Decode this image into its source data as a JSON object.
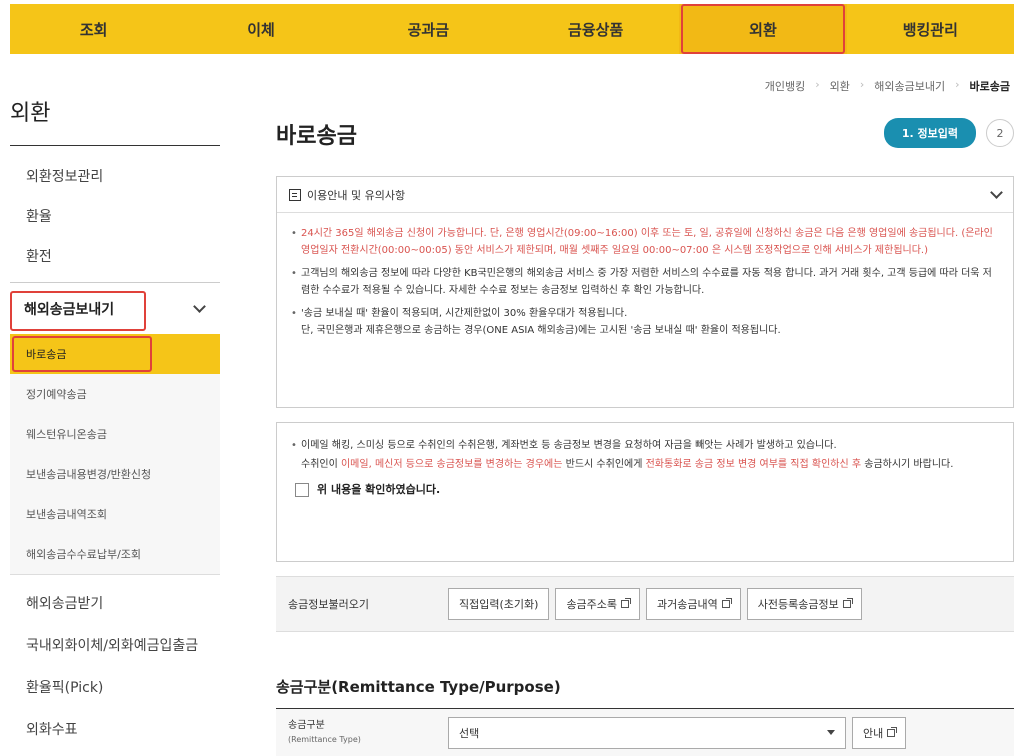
{
  "topnav": {
    "items": [
      "조회",
      "이체",
      "공과금",
      "금융상품",
      "외환",
      "뱅킹관리"
    ],
    "active_index": 4
  },
  "breadcrumb": [
    "개인뱅킹",
    "외환",
    "해외송금보내기",
    "바로송금"
  ],
  "sidebar": {
    "title": "외환",
    "items": [
      "외환정보관리",
      "환율",
      "환전"
    ],
    "group_label": "해외송금보내기",
    "sub_items": [
      "바로송금",
      "정기예약송금",
      "웨스턴유니온송금",
      "보낸송금내용변경/반환신청",
      "보낸송금내역조회",
      "해외송금수수료납부/조회"
    ],
    "after_items": [
      "해외송금받기",
      "국내외화이체/외화예금입출금",
      "환율픽(Pick)",
      "외화수표"
    ]
  },
  "main": {
    "title": "바로송금",
    "step_active": "1. 정보입력",
    "step_next": "2"
  },
  "notice": {
    "title": "이용안내 및 유의사항",
    "p1": "24시간 365일 해외송금 신청이 가능합니다. 단, 은행 영업시간(09:00~16:00) 이후 또는 토, 일, 공휴일에 신청하신 송금은 다음 은행 영업일에 송금됩니다. (은라인 영업일자 전환시간(00:00~00:05) 동안 서비스가 제한되며, 매월 셋째주 일요일 00:00~07:00 은 시스템 조정작업으로 인해 서비스가 제한됩니다.)",
    "p2": "고객님의 해외송금 정보에 따라 다양한 KB국민은행의 해외송금 서비스 중 가장 저렴한 서비스의 수수료를 자동 적용 합니다. 과거 거래 횟수, 고객 등급에 따라 더욱 저렴한 수수료가 적용될 수 있습니다. 자세한 수수료 정보는 송금정보 입력하신 후 확인 가능합니다.",
    "p3a": "'송금 보내실 때' 환율이 적용되며, 시간제한없이 30% 환율우대가 적용됩니다.",
    "p3b": "단, 국민은행과 제휴은행으로 송금하는 경우(ONE ASIA 해외송금)에는 고시된 '송금 보내실 때' 환율이 적용됩니다."
  },
  "warning": {
    "p1": "이메일 해킹, 스미싱 등으로 수취인의 수취은행, 계좌번호 등 송금정보 변경을 요청하여 자금을 빼앗는 사례가 발생하고 있습니다.",
    "p2_a": "수취인이 ",
    "p2_b": "이메일, 메신저 등으로 송금정보를 변경하는 경우에는",
    "p2_c": " 반드시 수취인에게 ",
    "p2_d": "전화통화로 송금 정보 변경 여부를 직접 확인하신 후",
    "p2_e": " 송금하시기 바랍니다.",
    "checkbox_label": "위 내용을 확인하였습니다."
  },
  "load": {
    "label": "송금정보불러오기",
    "buttons": [
      "직접입력(초기화)",
      "송금주소록",
      "과거송금내역",
      "사전등록송금정보"
    ]
  },
  "remit_type": {
    "section_title": "송금구분(Remittance Type/Purpose)",
    "label": "송금구분",
    "label_sub": "(Remittance Type)",
    "select_value": "선택",
    "guide_button": "안내"
  }
}
